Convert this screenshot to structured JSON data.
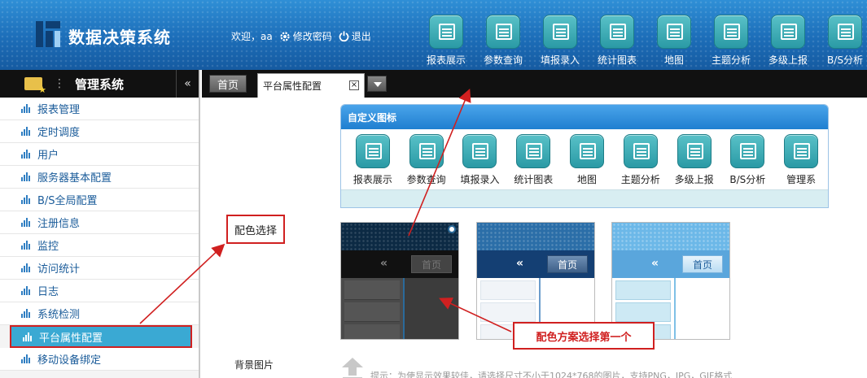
{
  "header": {
    "app_title": "数据决策系统",
    "welcome": "欢迎，aa",
    "change_password": "修改密码",
    "logout": "退出",
    "nav": [
      {
        "label": "报表展示",
        "icon": "report-icon"
      },
      {
        "label": "参数查询",
        "icon": "query-icon"
      },
      {
        "label": "填报录入",
        "icon": "entry-icon"
      },
      {
        "label": "统计图表",
        "icon": "chart-icon"
      },
      {
        "label": "地图",
        "icon": "map-icon"
      },
      {
        "label": "主题分析",
        "icon": "analysis-icon"
      },
      {
        "label": "多级上报",
        "icon": "report-up-icon"
      },
      {
        "label": "B/S分析",
        "icon": "bs-icon"
      }
    ]
  },
  "sidebar": {
    "title": "管理系统",
    "collapse": "«",
    "items": [
      {
        "label": "报表管理"
      },
      {
        "label": "定时调度"
      },
      {
        "label": "用户"
      },
      {
        "label": "服务器基本配置"
      },
      {
        "label": "B/S全局配置"
      },
      {
        "label": "注册信息"
      },
      {
        "label": "监控"
      },
      {
        "label": "访问统计"
      },
      {
        "label": "日志"
      },
      {
        "label": "系统检测"
      },
      {
        "label": "平台属性配置",
        "active": true
      },
      {
        "label": "移动设备绑定"
      }
    ]
  },
  "tabs": {
    "home": "首页",
    "active": "平台属性配置",
    "close": "☒"
  },
  "main": {
    "custom_icons": {
      "title": "自定义图标",
      "items": [
        {
          "label": "报表展示"
        },
        {
          "label": "参数查询"
        },
        {
          "label": "填报录入"
        },
        {
          "label": "统计图表"
        },
        {
          "label": "地图"
        },
        {
          "label": "主题分析"
        },
        {
          "label": "多级上报"
        },
        {
          "label": "B/S分析"
        },
        {
          "label": "管理系"
        }
      ]
    },
    "color_label": "配色选择",
    "theme_thumbs": [
      {
        "home": "首页",
        "chev": "«",
        "selected": true
      },
      {
        "home": "首页",
        "chev": "«",
        "selected": false
      },
      {
        "home": "首页",
        "chev": "«",
        "selected": false
      }
    ],
    "callout": "配色方案选择第一个",
    "bg_label": "背景图片",
    "hint": "提示：为使显示效果较佳，请选择尺寸不小于1024*768的图片，支持PNG，JPG，GIF格式"
  },
  "colors": {
    "accent": "#3aa9d3",
    "annotation": "#d02020",
    "header": "#1c6db8"
  }
}
